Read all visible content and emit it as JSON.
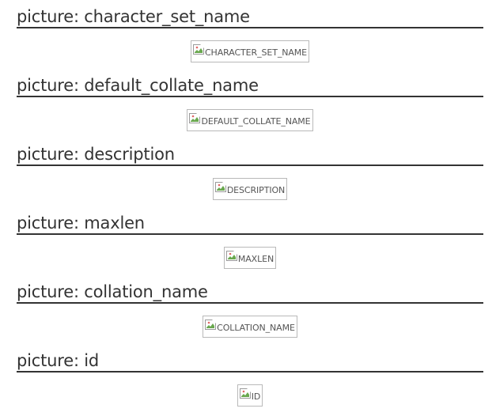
{
  "sections": [
    {
      "heading": "picture: character_set_name",
      "image_alt": "CHARACTER_SET_NAME"
    },
    {
      "heading": "picture: default_collate_name",
      "image_alt": "DEFAULT_COLLATE_NAME"
    },
    {
      "heading": "picture: description",
      "image_alt": "DESCRIPTION"
    },
    {
      "heading": "picture: maxlen",
      "image_alt": "MAXLEN"
    },
    {
      "heading": "picture: collation_name",
      "image_alt": "COLLATION_NAME"
    },
    {
      "heading": "picture: id",
      "image_alt": "ID"
    }
  ],
  "icons": {
    "broken_image": "broken-image-icon"
  }
}
